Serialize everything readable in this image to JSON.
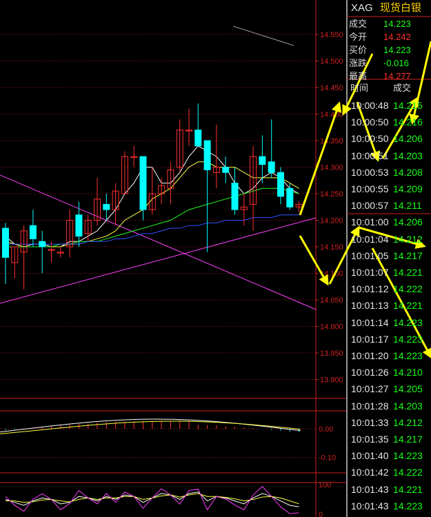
{
  "symbol": "XAG",
  "name": "现货白银",
  "quote": [
    {
      "label": "成交",
      "value": "14.223",
      "color": "#1aff1a"
    },
    {
      "label": "今开",
      "value": "14.242",
      "color": "#ff3030"
    },
    {
      "label": "买价",
      "value": "14.223",
      "color": "#1aff1a"
    },
    {
      "label": "涨跌",
      "value": "-0.016",
      "color": "#1aff1a"
    },
    {
      "label": "最高",
      "value": "14.277",
      "color": "#ff3030"
    }
  ],
  "ticks_header": {
    "time": "时间",
    "price": "成交"
  },
  "ticks": [
    {
      "time": "10:00:48",
      "price": "14.215"
    },
    {
      "time": "10:00:50",
      "price": "14.216"
    },
    {
      "time": "10:00:50",
      "price": "14.206"
    },
    {
      "time": "10:00:51",
      "price": "14.203"
    },
    {
      "time": "10:00:53",
      "price": "14.208"
    },
    {
      "time": "10:00:55",
      "price": "14.209"
    },
    {
      "time": "10:00:57",
      "price": "14.211"
    },
    {
      "time": "10:01:00",
      "price": "14.206"
    },
    {
      "time": "10:01:04",
      "price": "14.212"
    },
    {
      "time": "10:01:05",
      "price": "14.217"
    },
    {
      "time": "10:01:07",
      "price": "14.221"
    },
    {
      "time": "10:01:12",
      "price": "14.222"
    },
    {
      "time": "10:01:13",
      "price": "14.221"
    },
    {
      "time": "10:01:14",
      "price": "14.223"
    },
    {
      "time": "10:01:17",
      "price": "14.223"
    },
    {
      "time": "10:01:20",
      "price": "14.223"
    },
    {
      "time": "10:01:26",
      "price": "14.210"
    },
    {
      "time": "10:01:27",
      "price": "14.205"
    },
    {
      "time": "10:01:28",
      "price": "14.203"
    },
    {
      "time": "10:01:33",
      "price": "14.212"
    },
    {
      "time": "10:01:35",
      "price": "14.217"
    },
    {
      "time": "10:01:40",
      "price": "14.223"
    },
    {
      "time": "10:01:42",
      "price": "14.222"
    },
    {
      "time": "10:01:43",
      "price": "14.221"
    },
    {
      "time": "10:01:43",
      "price": "14.223"
    }
  ],
  "colors": {
    "up": "#ff3030",
    "down": "#00ffff",
    "grid": "#b01818",
    "axis": "#d02020",
    "ma5": "#ffffff",
    "ma10": "#ffff40",
    "ma20": "#20ff20",
    "ma60": "#3050ff",
    "line": "#ff40ff",
    "arrow": "#ffff00"
  },
  "chart_data": {
    "type": "candlestick",
    "ylim": [
      13.87,
      14.57
    ],
    "ytick_labels": [
      "14.550",
      "14.500",
      "14.450",
      "14.400",
      "14.350",
      "14.300",
      "14.250",
      "14.200",
      "14.150",
      "14.100",
      "14.050",
      "14.000",
      "13.950",
      "13.900"
    ],
    "ytick_values": [
      14.55,
      14.5,
      14.45,
      14.4,
      14.35,
      14.3,
      14.25,
      14.2,
      14.15,
      14.1,
      14.05,
      14.0,
      13.95,
      13.9
    ],
    "candles": [
      {
        "o": 14.185,
        "h": 14.195,
        "l": 14.08,
        "c": 14.13
      },
      {
        "o": 14.12,
        "h": 14.15,
        "l": 14.09,
        "c": 14.15
      },
      {
        "o": 14.14,
        "h": 14.19,
        "l": 14.07,
        "c": 14.18
      },
      {
        "o": 14.19,
        "h": 14.22,
        "l": 14.15,
        "c": 14.165
      },
      {
        "o": 14.16,
        "h": 14.18,
        "l": 14.1,
        "c": 14.15
      },
      {
        "o": 14.145,
        "h": 14.16,
        "l": 14.12,
        "c": 14.145
      },
      {
        "o": 14.14,
        "h": 14.15,
        "l": 14.13,
        "c": 14.14
      },
      {
        "o": 14.15,
        "h": 14.22,
        "l": 14.13,
        "c": 14.2
      },
      {
        "o": 14.21,
        "h": 14.235,
        "l": 14.15,
        "c": 14.17
      },
      {
        "o": 14.175,
        "h": 14.21,
        "l": 14.16,
        "c": 14.2
      },
      {
        "o": 14.2,
        "h": 14.28,
        "l": 14.19,
        "c": 14.24
      },
      {
        "o": 14.23,
        "h": 14.25,
        "l": 14.2,
        "c": 14.22
      },
      {
        "o": 14.22,
        "h": 14.27,
        "l": 14.19,
        "c": 14.255
      },
      {
        "o": 14.25,
        "h": 14.33,
        "l": 14.25,
        "c": 14.32
      },
      {
        "o": 14.32,
        "h": 14.34,
        "l": 14.3,
        "c": 14.32
      },
      {
        "o": 14.32,
        "h": 14.32,
        "l": 14.2,
        "c": 14.22
      },
      {
        "o": 14.22,
        "h": 14.3,
        "l": 14.21,
        "c": 14.25
      },
      {
        "o": 14.25,
        "h": 14.28,
        "l": 14.23,
        "c": 14.265
      },
      {
        "o": 14.26,
        "h": 14.31,
        "l": 14.23,
        "c": 14.295
      },
      {
        "o": 14.3,
        "h": 14.39,
        "l": 14.29,
        "c": 14.37
      },
      {
        "o": 14.37,
        "h": 14.41,
        "l": 14.34,
        "c": 14.37
      },
      {
        "o": 14.37,
        "h": 14.42,
        "l": 14.34,
        "c": 14.34
      },
      {
        "o": 14.35,
        "h": 14.35,
        "l": 14.14,
        "c": 14.295
      },
      {
        "o": 14.29,
        "h": 14.38,
        "l": 14.26,
        "c": 14.3
      },
      {
        "o": 14.3,
        "h": 14.32,
        "l": 14.27,
        "c": 14.29
      },
      {
        "o": 14.27,
        "h": 14.3,
        "l": 14.21,
        "c": 14.22
      },
      {
        "o": 14.22,
        "h": 14.25,
        "l": 14.19,
        "c": 14.225
      },
      {
        "o": 14.23,
        "h": 14.34,
        "l": 14.18,
        "c": 14.32
      },
      {
        "o": 14.32,
        "h": 14.36,
        "l": 14.27,
        "c": 14.305
      },
      {
        "o": 14.31,
        "h": 14.39,
        "l": 14.28,
        "c": 14.29
      },
      {
        "o": 14.29,
        "h": 14.3,
        "l": 14.23,
        "c": 14.245
      },
      {
        "o": 14.26,
        "h": 14.27,
        "l": 14.22,
        "c": 14.225
      },
      {
        "o": 14.225,
        "h": 14.235,
        "l": 14.215,
        "c": 14.23
      }
    ],
    "ma_lines": [
      {
        "name": "MA5",
        "values": [
          14.17,
          14.155,
          14.15,
          14.155,
          14.155,
          14.15,
          14.15,
          14.16,
          14.16,
          14.17,
          14.18,
          14.2,
          14.22,
          14.25,
          14.27,
          14.3,
          14.3,
          14.27,
          14.27,
          14.29,
          14.32,
          14.34,
          14.33,
          14.32,
          14.3,
          14.27,
          14.25,
          14.26,
          14.28,
          14.29,
          14.28,
          14.26,
          14.25
        ]
      },
      {
        "name": "MA10",
        "values": [
          14.16,
          14.155,
          14.15,
          14.15,
          14.15,
          14.15,
          14.15,
          14.155,
          14.155,
          14.16,
          14.165,
          14.17,
          14.18,
          14.2,
          14.21,
          14.22,
          14.24,
          14.25,
          14.26,
          14.28,
          14.3,
          14.31,
          14.31,
          14.3,
          14.3,
          14.3,
          14.29,
          14.28,
          14.28,
          14.28,
          14.28,
          14.27,
          14.26
        ]
      },
      {
        "name": "MA20",
        "values": [
          14.15,
          14.15,
          14.15,
          14.15,
          14.15,
          14.15,
          14.155,
          14.155,
          14.16,
          14.16,
          14.16,
          14.165,
          14.17,
          14.175,
          14.18,
          14.185,
          14.19,
          14.195,
          14.2,
          14.21,
          14.22,
          14.225,
          14.23,
          14.235,
          14.24,
          14.245,
          14.25,
          14.255,
          14.26,
          14.26,
          14.26,
          14.255,
          14.25
        ]
      },
      {
        "name": "MA60",
        "values": [
          14.155,
          14.155,
          14.155,
          14.155,
          14.155,
          14.155,
          14.155,
          14.155,
          14.155,
          14.16,
          14.16,
          14.16,
          14.165,
          14.165,
          14.17,
          14.175,
          14.175,
          14.18,
          14.185,
          14.185,
          14.19,
          14.19,
          14.195,
          14.195,
          14.2,
          14.2,
          14.2,
          14.205,
          14.205,
          14.205,
          14.21,
          14.21,
          14.21
        ]
      }
    ],
    "macd": {
      "ytick_labels": [
        "0.00",
        "-0.10"
      ],
      "ytick_values": [
        0.0,
        -0.1
      ],
      "ylim": [
        -0.135,
        0.06
      ]
    },
    "kdj": {
      "ytick_labels": [
        "100",
        "0"
      ],
      "ytick_values": [
        100,
        0
      ],
      "ylim": [
        0,
        110
      ]
    }
  }
}
